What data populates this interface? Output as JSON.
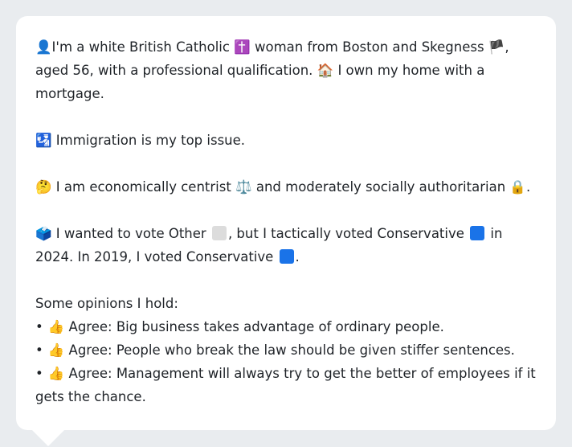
{
  "profile": {
    "p1_a": "I'm a white British Catholic ",
    "p1_b": " woman from Boston and Skegness ",
    "p1_c": ", aged 56, with a professional qualification. ",
    "p1_d": " I own my home with a mortgage.",
    "icons": {
      "person": "👤",
      "cross": "✝️",
      "flag": "🏴",
      "house": "🏠",
      "immigration": "🛂",
      "thinking": "🤔",
      "scales": "⚖️",
      "lock": "🔒",
      "ballot": "🗳️",
      "thumbs": "👍"
    },
    "p2": " Immigration is my top issue.",
    "p3_a": " I am economically centrist ",
    "p3_b": " and moderately socially authoritarian ",
    "p3_c": ".",
    "p4_a": " I wanted to vote Other ",
    "p4_b": ", but I tactically voted Conservative ",
    "p4_c": " in 2024. In 2019, I voted Conservative ",
    "p4_d": ".",
    "opinions_header": "Some opinions I hold:",
    "bullet_char": "•",
    "opinions": [
      " Agree: Big business takes advantage of ordinary people.",
      " Agree: People who break the law should be given stiffer sentences.",
      " Agree: Management will always try to get the better of employees if it gets the chance."
    ],
    "colors": {
      "other": "#dcdcdc",
      "conservative": "#1a73e8"
    }
  }
}
